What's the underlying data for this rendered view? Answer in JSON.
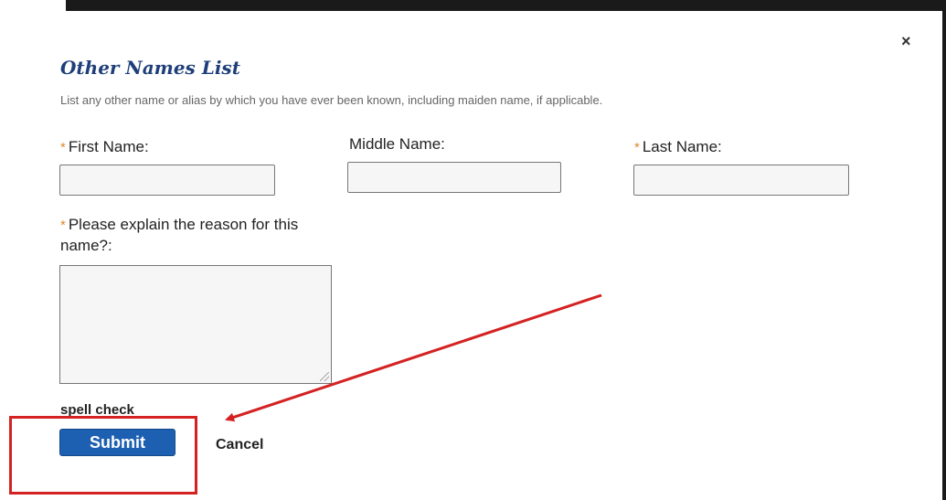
{
  "dialog": {
    "title": "Other Names List",
    "instruction": "List any other name or alias by which you have ever been known, including maiden name, if applicable.",
    "close_glyph": "×"
  },
  "fields": {
    "required_marker": "*",
    "first_name": {
      "label": "First Name:",
      "value": ""
    },
    "middle_name": {
      "label": "Middle Name:",
      "value": ""
    },
    "last_name": {
      "label": "Last Name:",
      "value": ""
    },
    "reason": {
      "label": "Please explain the reason for this name?:",
      "value": ""
    }
  },
  "actions": {
    "spell_check": "spell check",
    "submit": "Submit",
    "cancel": "Cancel"
  },
  "annotation": {
    "color": "#d42121"
  },
  "colors": {
    "title": "#1f3f7a",
    "required": "#e08a2e",
    "submit_bg": "#1d5fb1"
  }
}
